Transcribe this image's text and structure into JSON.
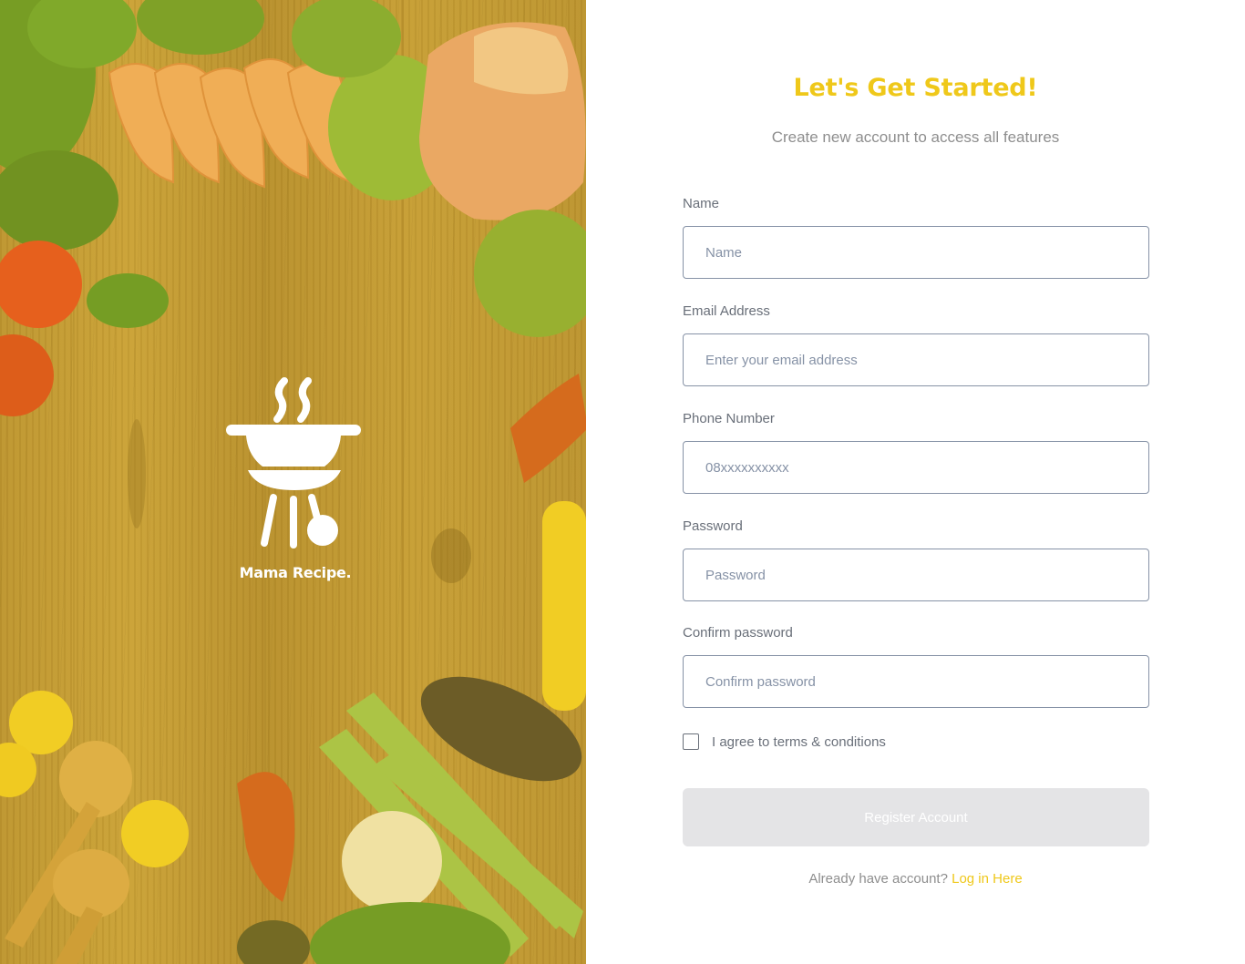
{
  "brand": {
    "name": "Mama Recipe.",
    "logo_icon": "grill-icon"
  },
  "colors": {
    "accent": "#efc81a",
    "hero_tint": "#efc81a",
    "input_border": "#8692a6",
    "label": "#696f79",
    "button_disabled_bg": "#e4e4e6"
  },
  "form": {
    "title": "Let's Get Started!",
    "subtitle": "Create new account to access all features",
    "fields": [
      {
        "label": "Name",
        "placeholder": "Name",
        "value": ""
      },
      {
        "label": "Email Address",
        "placeholder": "Enter your email address",
        "value": ""
      },
      {
        "label": "Phone Number",
        "placeholder": "08xxxxxxxxxx",
        "value": ""
      },
      {
        "label": "Password",
        "placeholder": "Password",
        "value": ""
      },
      {
        "label": "Confirm password",
        "placeholder": "Confirm password",
        "value": ""
      }
    ],
    "agree_label": "I agree to terms & conditions",
    "agree_checked": false,
    "submit_label": "Register Account",
    "login_prompt": "Already have account?",
    "login_link": "Log in Here"
  }
}
